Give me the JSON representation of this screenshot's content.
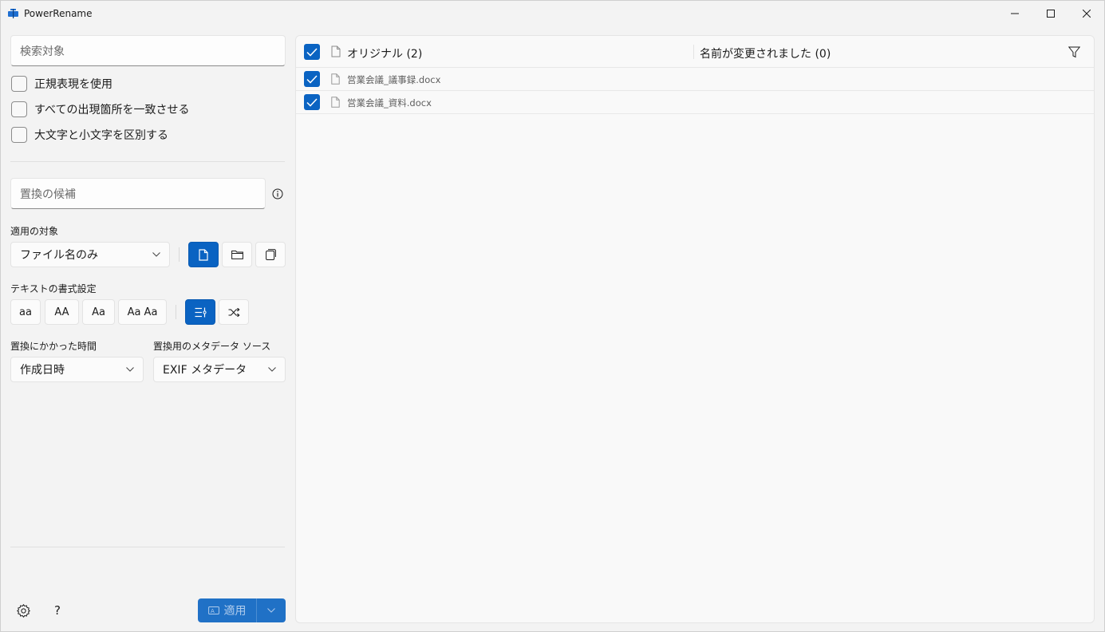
{
  "window": {
    "title": "PowerRename"
  },
  "search": {
    "placeholder": "検索対象",
    "options": [
      {
        "label": "正規表現を使用",
        "checked": false
      },
      {
        "label": "すべての出現箇所を一致させる",
        "checked": false
      },
      {
        "label": "大文字と小文字を区別する",
        "checked": false
      }
    ]
  },
  "replace": {
    "placeholder": "置換の候補",
    "info_icon": "info-icon"
  },
  "apply_to": {
    "label": "適用の対象",
    "selected": "ファイル名のみ",
    "buttons": [
      {
        "icon": "file-icon",
        "active": true
      },
      {
        "icon": "folder-icon",
        "active": false
      },
      {
        "icon": "subfolder-icon",
        "active": false
      }
    ]
  },
  "text_format": {
    "label": "テキストの書式設定",
    "buttons": [
      "aa",
      "AA",
      "Aa",
      "Aa Aa"
    ],
    "extra_buttons": [
      {
        "icon": "enumerate-icon",
        "active": true
      },
      {
        "icon": "shuffle-icon",
        "active": false
      }
    ]
  },
  "time": {
    "label": "置換にかかった時間",
    "selected": "作成日時"
  },
  "metadata": {
    "label": "置換用のメタデータ ソース",
    "selected": "EXIF メタデータ"
  },
  "footer": {
    "settings_icon": "gear-icon",
    "help_label": "?",
    "apply_label": "適用"
  },
  "list": {
    "original_header": "オリジナル (2)",
    "renamed_header": "名前が変更されました (0)",
    "rows": [
      {
        "name": "営業会議_議事録.docx",
        "checked": true
      },
      {
        "name": "営業会議_資料.docx",
        "checked": true
      }
    ]
  },
  "colors": {
    "accent": "#0a63c2",
    "background": "#f3f3f3"
  }
}
